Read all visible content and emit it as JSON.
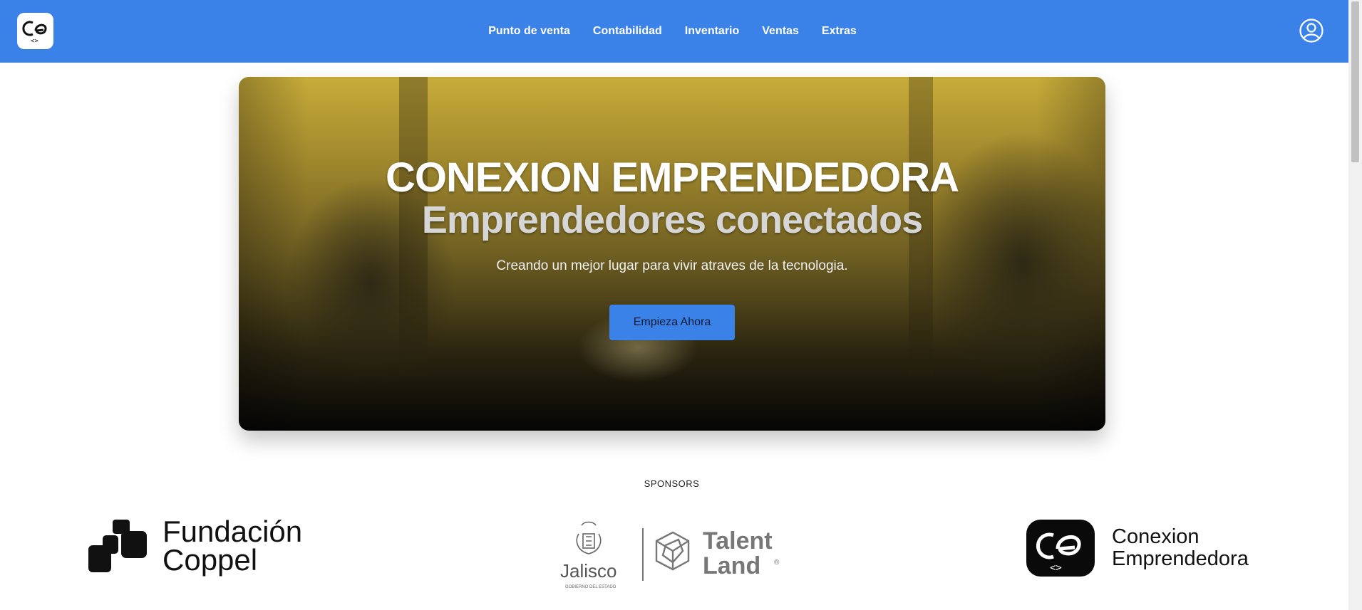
{
  "navbar": {
    "logo_icon": "conexion-emprendedora-logo",
    "links": [
      {
        "label": "Punto de venta"
      },
      {
        "label": "Contabilidad"
      },
      {
        "label": "Inventario"
      },
      {
        "label": "Ventas"
      },
      {
        "label": "Extras"
      }
    ],
    "user_icon": "user-circle-icon",
    "background_color": "#3b82e8"
  },
  "hero": {
    "title": "CONEXION EMPRENDEDORA",
    "subtitle": "Emprendedores conectados",
    "tagline": "Creando un mejor lugar para vivir atraves de la tecnologia.",
    "cta_label": "Empieza Ahora",
    "cta_color": "#3b82e8",
    "overlay_color": "#c8ac3a"
  },
  "sponsors": {
    "heading": "SPONSORS",
    "items": [
      {
        "name_line1": "Fundación",
        "name_line2": "Coppel"
      },
      {
        "name_left": "Jalisco",
        "name_left_sub": "GOBIERNO DEL ESTADO",
        "name_right_line1": "Talent",
        "name_right_line2": "Land",
        "mark": "®"
      },
      {
        "name_line1": "Conexion",
        "name_line2": "Emprendedora"
      }
    ]
  }
}
